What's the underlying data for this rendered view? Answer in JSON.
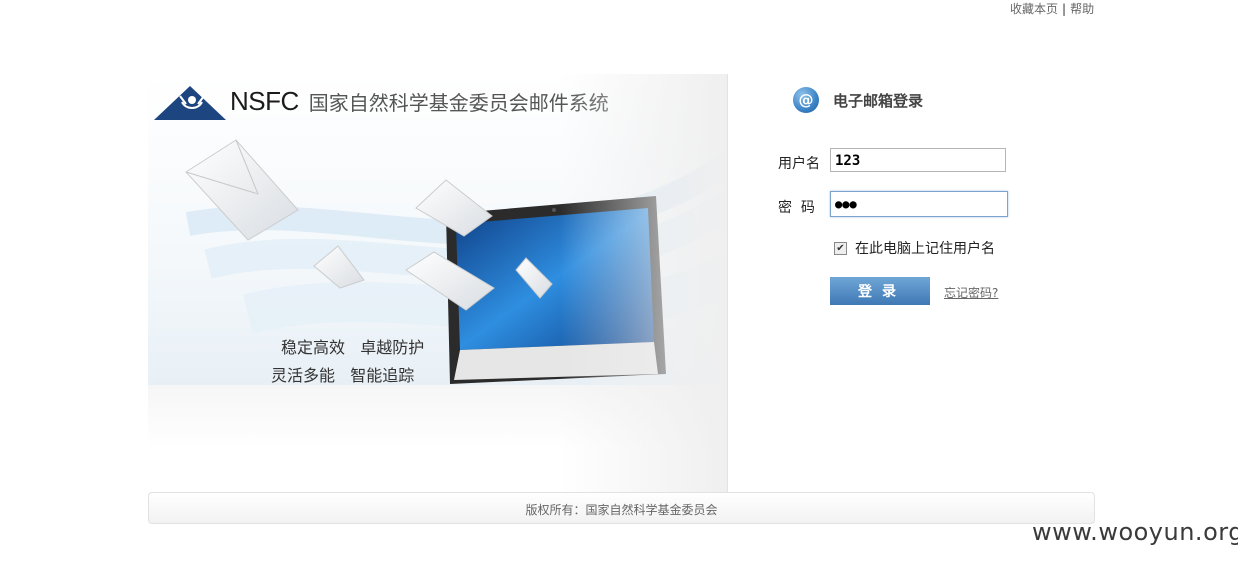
{
  "top_links": {
    "bookmark": "收藏本页",
    "separator": "|",
    "help": "帮助"
  },
  "banner": {
    "logo_text": "NSFC",
    "system_title": "国家自然科学基金委员会邮件系统",
    "slogan_line1": "稳定高效   卓越防护",
    "slogan_line2": "灵活多能   智能追踪"
  },
  "login": {
    "title": "电子邮箱登录",
    "username_label": "用户名",
    "username_value": "123",
    "password_label": "密  码",
    "password_value": "●●●",
    "remember_label": "在此电脑上记住用户名",
    "remember_checked": true,
    "submit_label": "登录",
    "forgot_label": "忘记密码?"
  },
  "footer": {
    "copyright": "版权所有：国家自然科学基金委员会"
  },
  "watermark": "www.wooyun.org",
  "colors": {
    "accent": "#3f79b5",
    "logo_navy": "#1d4580"
  }
}
